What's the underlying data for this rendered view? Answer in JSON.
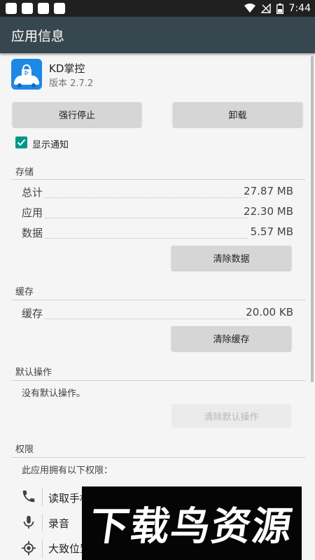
{
  "status_bar": {
    "time": "7:44"
  },
  "app_bar": {
    "title": "应用信息"
  },
  "app": {
    "name": "KD掌控",
    "version": "版本 2.7.2"
  },
  "actions": {
    "force_stop": "强行停止",
    "uninstall": "卸载"
  },
  "notifications": {
    "label": "显示通知",
    "checked": true
  },
  "storage": {
    "title": "存储",
    "rows": [
      {
        "label": "总计",
        "value": "27.87 MB"
      },
      {
        "label": "应用",
        "value": "22.30 MB"
      },
      {
        "label": "数据",
        "value": "5.57 MB"
      }
    ],
    "clear_button": "清除数据"
  },
  "cache": {
    "title": "缓存",
    "row": {
      "label": "缓存",
      "value": "20.00 KB"
    },
    "clear_button": "清除缓存"
  },
  "default_actions": {
    "title": "默认操作",
    "text": "没有默认操作。",
    "clear_button": "清除默认操作"
  },
  "permissions": {
    "title": "权限",
    "intro": "此应用拥有以下权限：",
    "items": [
      {
        "icon": "phone-icon",
        "text": "读取手机"
      },
      {
        "icon": "microphone-icon",
        "text": "录音"
      },
      {
        "icon": "location-icon",
        "text": "大致位置"
      }
    ]
  },
  "watermark": {
    "text": "下载鸟资源"
  },
  "colors": {
    "app_bar": "#37474f",
    "status_bar": "#202020",
    "accent": "#009688",
    "app_icon": "#1e88e5"
  }
}
